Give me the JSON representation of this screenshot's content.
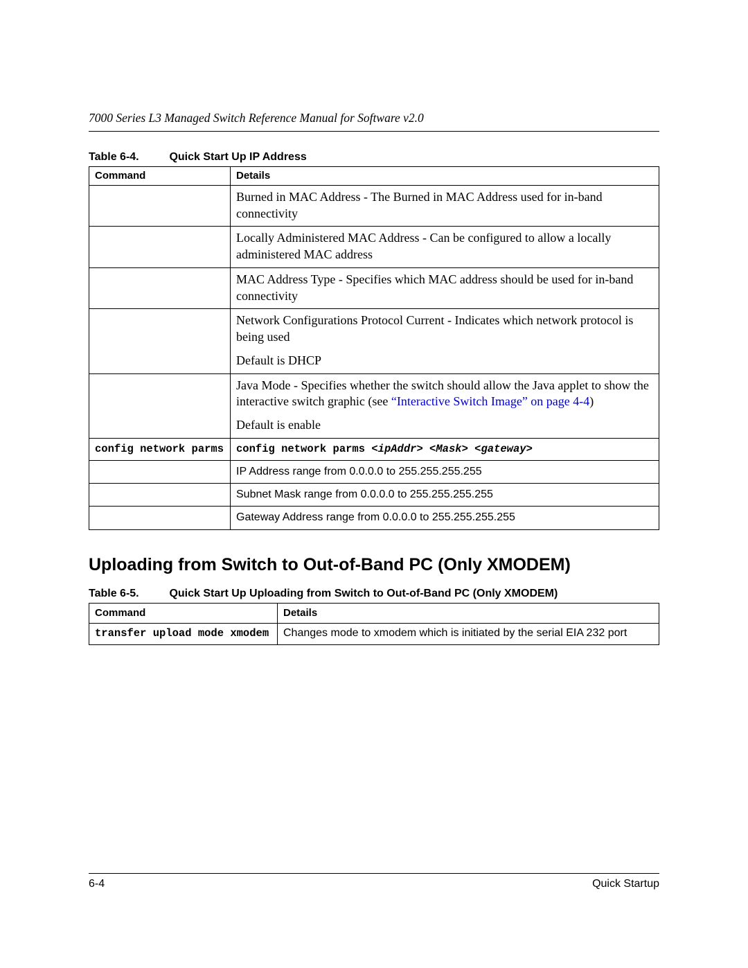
{
  "running_head": "7000 Series L3 Managed Switch Reference Manual for Software v2.0",
  "table1": {
    "caption_num": "Table 6-4.",
    "caption_title": "Quick Start Up IP Address",
    "head_command": "Command",
    "head_details": "Details",
    "rows": {
      "r1": "Burned in MAC Address - The Burned in MAC Address used for in-band connectivity",
      "r2": "Locally Administered MAC Address - Can be configured to allow a locally administered MAC address",
      "r3": "MAC Address Type - Specifies which MAC address should be used for in-band connectivity",
      "r4a": "Network Configurations Protocol Current - Indicates which network protocol is being used",
      "r4b": "Default is DHCP",
      "r5a_pre": "Java Mode - Specifies whether the switch should allow the Java applet to show the interactive switch graphic (see ",
      "r5a_link1": "“Interactive Switch Image” on page 4-4",
      "r5a_post": ")",
      "r5b": "Default is enable",
      "r6_cmd": "config network parms",
      "r6_det_pre": "config network parms ",
      "r6_det_args": "<ipAddr> <Mask> <gateway>",
      "r7": "IP Address range from 0.0.0.0 to 255.255.255.255",
      "r8": "Subnet Mask range from 0.0.0.0 to 255.255.255.255",
      "r9": "Gateway Address range from 0.0.0.0 to 255.255.255.255"
    }
  },
  "section_heading": "Uploading from Switch to Out-of-Band PC (Only XMODEM)",
  "table2": {
    "caption_num": "Table 6-5.",
    "caption_title": "Quick Start Up Uploading from Switch to Out-of-Band PC (Only XMODEM)",
    "head_command": "Command",
    "head_details": "Details",
    "row_cmd": "transfer upload mode xmodem",
    "row_det": "Changes mode to xmodem which is initiated by the serial EIA 232 port"
  },
  "footer": {
    "left": "6-4",
    "right": "Quick Startup"
  }
}
